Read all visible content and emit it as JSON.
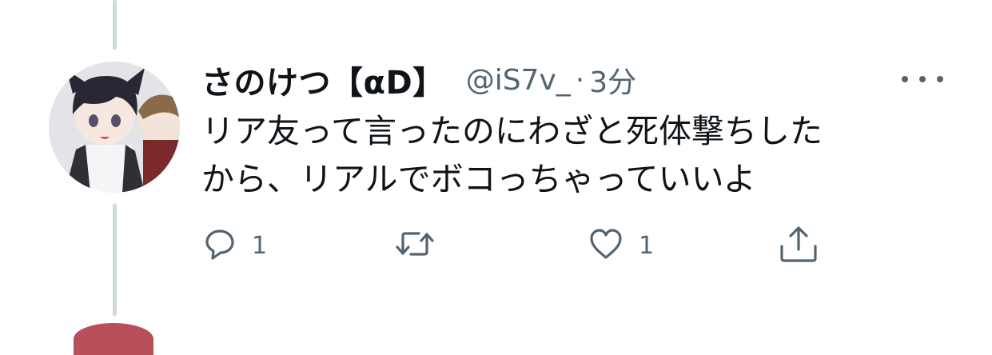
{
  "tweet": {
    "display_name": "さのけつ【αD】",
    "handle": "@iS7v_",
    "separator": "·",
    "time": "3分",
    "text_lines": [
      "リア友って言ったのにわざと死体撃ちした",
      "から、リアルでボコっちゃっていいよ"
    ],
    "actions": {
      "reply_icon": "reply-icon",
      "reply_count": "1",
      "retweet_icon": "retweet-icon",
      "retweet_count": "",
      "like_icon": "heart-icon",
      "like_count": "1",
      "share_icon": "share-icon"
    }
  },
  "colors": {
    "text_primary": "#0f1419",
    "text_secondary": "#536471",
    "thread_line": "#cfd9de"
  }
}
